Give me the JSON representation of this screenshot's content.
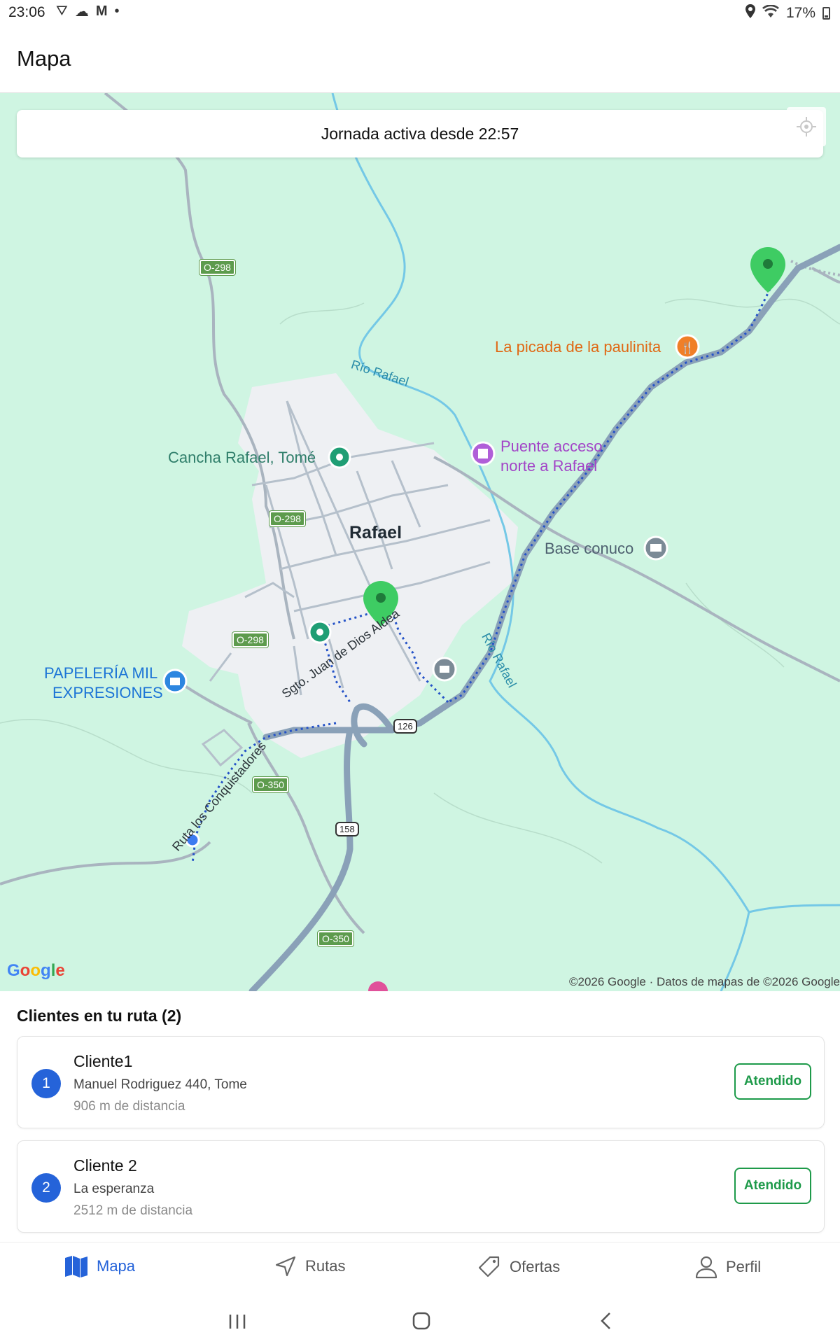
{
  "status_bar": {
    "time": "23:06",
    "battery": "17%"
  },
  "app_bar": {
    "title": "Mapa"
  },
  "map": {
    "banner": "Jornada activa desde 22:57",
    "town": "Rafael",
    "places": {
      "cancha": "Cancha Rafael, Tomé",
      "picada": "La picada de la paulinita",
      "puente_l1": "Puente acceso",
      "puente_l2": "norte a Rafael",
      "base": "Base conuco",
      "papeleria_l1": "PAPELERÍA MIL",
      "papeleria_l2": "EXPRESIONES"
    },
    "rivers": {
      "r1": "Río Rafael",
      "r2": "Río Rafael"
    },
    "streets": {
      "s1": "Sgto. Juan de Dios Aldea",
      "s2": "Ruta los Conquistadores"
    },
    "shields": {
      "a": "O-298",
      "b": "O-298",
      "c": "O-298",
      "d": "O-350",
      "e": "O-350"
    },
    "highways": {
      "h126": "126",
      "h158": "158"
    },
    "logo": "Google",
    "copyright": "©2026 Google · Datos de mapas de ©2026 Google"
  },
  "clients": {
    "title": "Clientes en tu ruta (2)",
    "items": [
      {
        "num": "1",
        "name": "Cliente1",
        "address": "Manuel Rodriguez 440, Tome",
        "distance": "906 m de distancia",
        "action": "Atendido"
      },
      {
        "num": "2",
        "name": "Cliente 2",
        "address": "La esperanza",
        "distance": "2512 m de distancia",
        "action": "Atendido"
      }
    ]
  },
  "nav": {
    "mapa": "Mapa",
    "rutas": "Rutas",
    "ofertas": "Ofertas",
    "perfil": "Perfil"
  },
  "colors": {
    "accent": "#2563d9",
    "success": "#1e9a4a",
    "map_bg": "#cff5e2"
  }
}
